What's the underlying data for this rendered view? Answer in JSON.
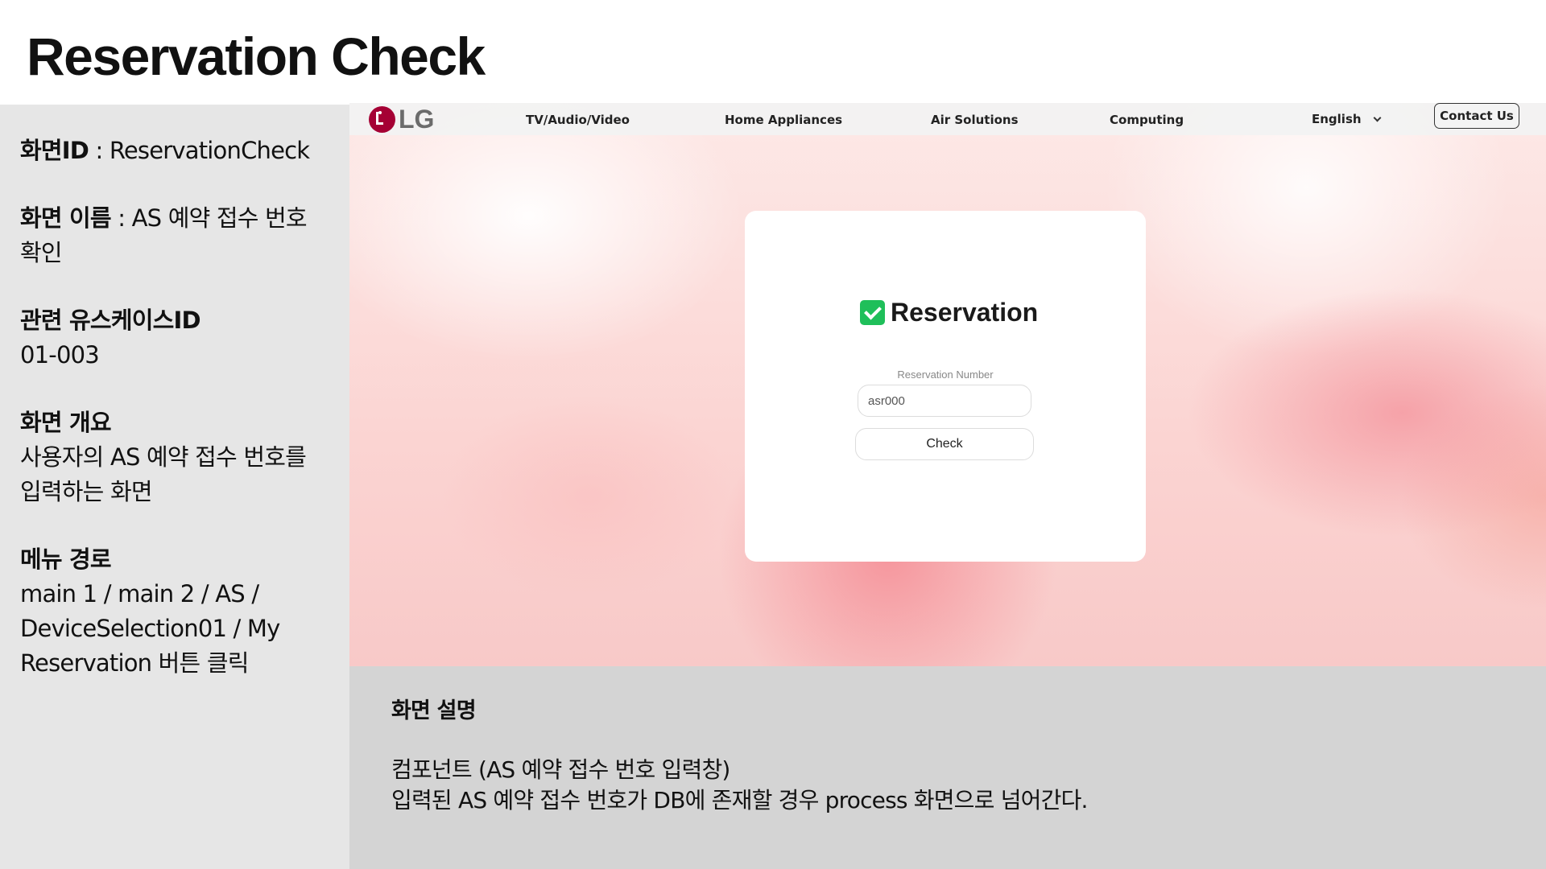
{
  "slide": {
    "title": "Reservation Check"
  },
  "meta": {
    "screen_id_label": "화면ID",
    "screen_id_value": " : ReservationCheck",
    "screen_name_label": "화면 이름",
    "screen_name_value": " : AS 예약 접수 번호 확인",
    "usecase_label": "관련 유스케이스ID",
    "usecase_value": "01-003",
    "overview_label": "화면 개요",
    "overview_value": "사용자의 AS 예약 접수 번호를 입력하는 화면",
    "menu_path_label": "메뉴 경로",
    "menu_path_value": "main 1  / main 2  / AS / DeviceSelection01 / My Reservation 버튼 클릭"
  },
  "app": {
    "logo_text": "LG",
    "nav": {
      "tv": "TV/Audio/Video",
      "home": "Home Appliances",
      "air": "Air Solutions",
      "computing": "Computing",
      "language": "English",
      "contact": "Contact Us"
    },
    "card": {
      "title": "Reservation",
      "field_label": "Reservation Number",
      "input_placeholder": "asr000",
      "check_button": "Check"
    }
  },
  "description": {
    "title": "화면 설명",
    "line1": "컴포넌트 (AS 예약 접수 번호 입력창)",
    "line2": "입력된 AS 예약 접수 번호가 DB에 존재할 경우 process 화면으로 넘어간다."
  },
  "colors": {
    "lg_red": "#a50034",
    "check_green": "#1fbf5a",
    "left_panel_bg": "#e6e6e6",
    "desc_panel_bg": "#d4d4d4"
  }
}
